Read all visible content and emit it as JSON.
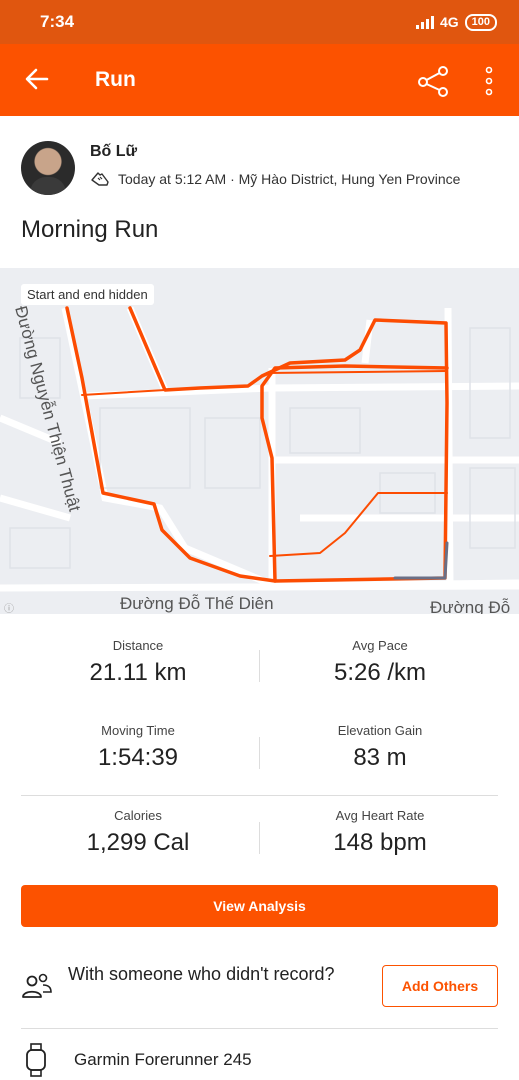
{
  "status_bar": {
    "time": "7:34",
    "network": "4G",
    "battery": "100"
  },
  "app_bar": {
    "title": "Run"
  },
  "activity": {
    "athlete": "Bố Lữ",
    "meta": "Today at 5:12 AM · Mỹ Hào District, Hung Yen Province",
    "title": "Morning Run"
  },
  "map": {
    "badge": "Start and end hidden",
    "streets": [
      "Đường Nguyễn Thiện Thuật",
      "Đường Đỗ Thế Diên",
      "Đường Đỗ"
    ],
    "route_color": "#fc4c02"
  },
  "stats": [
    {
      "label": "Distance",
      "value": "21.11 km"
    },
    {
      "label": "Avg Pace",
      "value": "5:26 /km"
    },
    {
      "label": "Moving Time",
      "value": "1:54:39"
    },
    {
      "label": "Elevation Gain",
      "value": "83 m"
    },
    {
      "label": "Calories",
      "value": "1,299 Cal"
    },
    {
      "label": "Avg Heart Rate",
      "value": "148 bpm"
    }
  ],
  "actions": {
    "view_analysis": "View Analysis",
    "with_someone": "With someone who didn't record?",
    "add_others": "Add Others"
  },
  "device": {
    "name": "Garmin Forerunner 245"
  },
  "colors": {
    "brand": "#fc5200",
    "status_bar": "#e0560f"
  }
}
